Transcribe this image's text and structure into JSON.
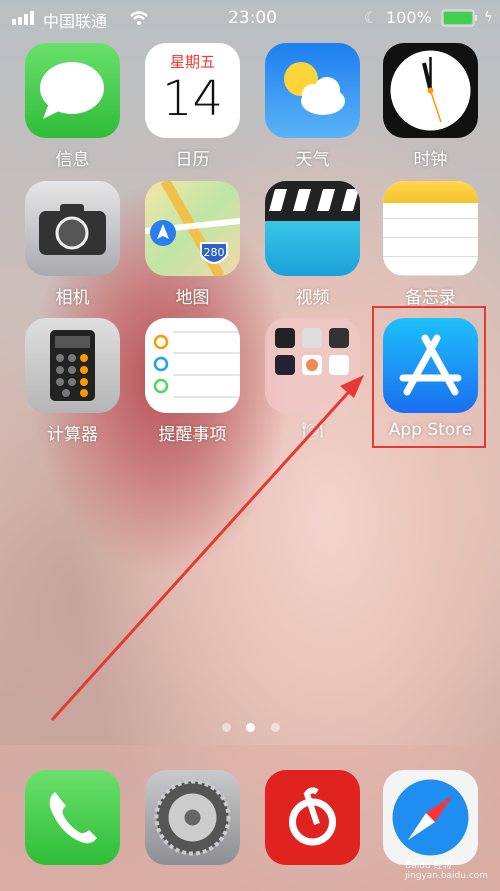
{
  "status_bar": {
    "carrier": "中国联通",
    "time": "23:00",
    "battery": "100%",
    "battery_level": 100,
    "signal_bars": 4,
    "icons": [
      "signal-icon",
      "wifi-icon",
      "moon-icon",
      "battery-icon",
      "charging-icon"
    ]
  },
  "apps": [
    {
      "label": "信息",
      "icon": "messages-icon"
    },
    {
      "label": "日历",
      "icon": "calendar-icon",
      "weekday": "星期五",
      "day": "14"
    },
    {
      "label": "天气",
      "icon": "weather-icon"
    },
    {
      "label": "时钟",
      "icon": "clock-icon"
    },
    {
      "label": "相机",
      "icon": "camera-icon"
    },
    {
      "label": "地图",
      "icon": "maps-icon",
      "road_sign": "280"
    },
    {
      "label": "视频",
      "icon": "videos-icon"
    },
    {
      "label": "备忘录",
      "icon": "notes-icon"
    },
    {
      "label": "计算器",
      "icon": "calculator-icon"
    },
    {
      "label": "提醒事项",
      "icon": "reminders-icon"
    },
    {
      "label": "🍽",
      "icon": "folder-icon"
    },
    {
      "label": "App Store",
      "icon": "app-store-icon",
      "highlighted": true
    }
  ],
  "page_indicator": {
    "pages": 3,
    "current": 2
  },
  "dock": [
    {
      "icon": "phone-icon"
    },
    {
      "icon": "settings-icon"
    },
    {
      "icon": "netease-music-icon"
    },
    {
      "icon": "safari-icon"
    }
  ],
  "watermark": "Baidu 经验 jingyan.baidu.com",
  "colors": {
    "highlight": "#e53935",
    "app_store": "#1a8cf0"
  }
}
